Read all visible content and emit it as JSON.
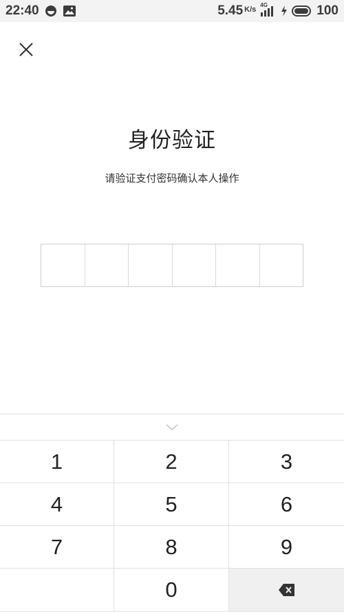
{
  "status_bar": {
    "time": "22:40",
    "speed": "5.45",
    "speed_unit": "K/s",
    "network": "4G",
    "battery": "100"
  },
  "title": "身份验证",
  "subtitle": "请验证支付密码确认本人操作",
  "pin_length": 6,
  "keypad": {
    "keys": [
      "1",
      "2",
      "3",
      "4",
      "5",
      "6",
      "7",
      "8",
      "9",
      "",
      "0",
      "delete"
    ]
  },
  "colors": {
    "status_bar_bg": "#f3f3f3",
    "border": "#dcdcdc",
    "delete_key_bg": "#f0f0f0"
  }
}
